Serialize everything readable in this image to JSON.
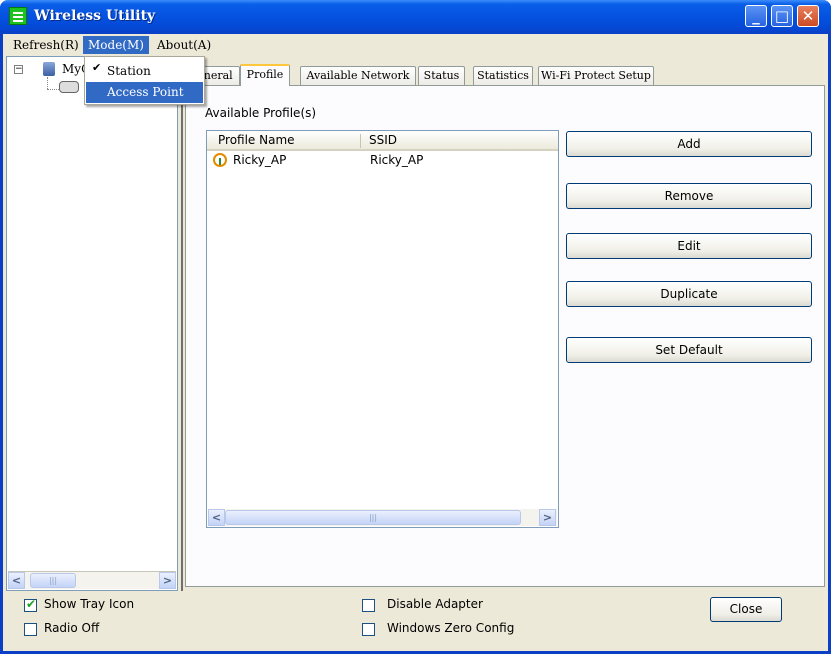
{
  "window": {
    "title": "Wireless Utility"
  },
  "menu": {
    "refresh": "Refresh(R)",
    "mode": "Mode(M)",
    "about": "About(A)",
    "mode_items": {
      "station": "Station",
      "access_point": "Access Point"
    },
    "check_mark": "✔"
  },
  "tree": {
    "root_label": "MyC",
    "collapse_glyph": "−"
  },
  "tabs": {
    "general": "eneral",
    "profile": "Profile",
    "available_network": "Available Network",
    "status": "Status",
    "statistics": "Statistics",
    "wps": "Wi-Fi Protect Setup"
  },
  "profile": {
    "available_label": "Available Profile(s)",
    "columns": {
      "profile_name": "Profile Name",
      "ssid": "SSID"
    },
    "rows": [
      {
        "profile_name": "Ricky_AP",
        "ssid": "Ricky_AP"
      }
    ],
    "buttons": {
      "add": "Add",
      "remove": "Remove",
      "edit": "Edit",
      "duplicate": "Duplicate",
      "set_default": "Set Default"
    }
  },
  "options": {
    "show_tray_icon": {
      "label": "Show Tray Icon",
      "checked": true
    },
    "radio_off": {
      "label": "Radio Off",
      "checked": false
    },
    "disable_adapter": {
      "label": "Disable Adapter",
      "checked": false
    },
    "windows_zero_config": {
      "label": "Windows Zero Config",
      "checked": false
    },
    "check_glyph": "✔"
  },
  "footer": {
    "close": "Close"
  },
  "colors": {
    "titlebar": "#0553e1",
    "menu_highlight": "#316ac5",
    "tab_accent": "#ffc83c",
    "button_border": "#003c74"
  }
}
